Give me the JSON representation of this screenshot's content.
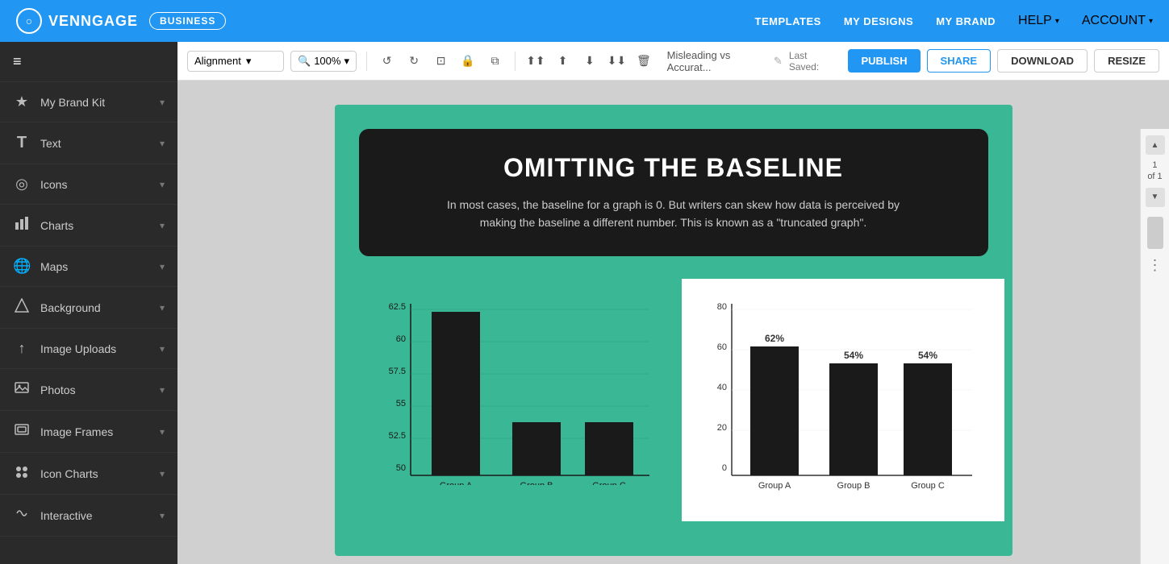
{
  "topnav": {
    "logo_text": "VENNGAGE",
    "logo_icon": "○",
    "business_badge": "BUSINESS",
    "links": [
      "TEMPLATES",
      "MY DESIGNS",
      "MY BRAND"
    ],
    "dropdowns": [
      "HELP",
      "ACCOUNT"
    ]
  },
  "toolbar": {
    "alignment_label": "Alignment",
    "zoom_label": "100%",
    "zoom_icon": "🔍",
    "title": "Misleading vs Accurat...",
    "save_label": "Last Saved:",
    "publish_label": "PUBLISH",
    "share_label": "SHARE",
    "download_label": "DOWNLOAD",
    "resize_label": "RESIZE"
  },
  "sidebar": {
    "hamburger_icon": "≡",
    "items": [
      {
        "id": "my-brand-kit",
        "icon": "★",
        "label": "My Brand Kit"
      },
      {
        "id": "text",
        "icon": "T",
        "label": "Text"
      },
      {
        "id": "icons",
        "icon": "◎",
        "label": "Icons"
      },
      {
        "id": "charts",
        "icon": "📊",
        "label": "Charts"
      },
      {
        "id": "maps",
        "icon": "🌐",
        "label": "Maps"
      },
      {
        "id": "background",
        "icon": "△",
        "label": "Background"
      },
      {
        "id": "image-uploads",
        "icon": "↑",
        "label": "Image Uploads"
      },
      {
        "id": "photos",
        "icon": "🖼",
        "label": "Photos"
      },
      {
        "id": "image-frames",
        "icon": "▢",
        "label": "Image Frames"
      },
      {
        "id": "icon-charts",
        "icon": "👥",
        "label": "Icon Charts"
      },
      {
        "id": "interactive",
        "icon": "⟳",
        "label": "Interactive"
      }
    ]
  },
  "canvas": {
    "bg_color": "#3ab795",
    "title_card": {
      "heading": "OMITTING THE BASELINE",
      "body": "In most cases, the baseline for a graph is 0. But writers can skew how data is perceived by making the baseline a different number. This is known as a \"truncated graph\"."
    },
    "left_chart": {
      "y_labels": [
        "62.5",
        "60",
        "57.5",
        "55",
        "52.5",
        "50"
      ],
      "x_labels": [
        "Group A",
        "Group B",
        "Group C"
      ],
      "bars": [
        {
          "group": "Group A",
          "value": 62,
          "height_pct": 95
        },
        {
          "group": "Group B",
          "value": 54,
          "height_pct": 38
        },
        {
          "group": "Group C",
          "value": 54,
          "height_pct": 35
        }
      ]
    },
    "right_chart": {
      "y_labels": [
        "80",
        "60",
        "40",
        "20",
        "0"
      ],
      "x_labels": [
        "Group A",
        "Group B",
        "Group C"
      ],
      "bars": [
        {
          "group": "Group A",
          "value": "62%",
          "height_pct": 77
        },
        {
          "group": "Group B",
          "value": "54%",
          "height_pct": 67
        },
        {
          "group": "Group C",
          "value": "54%",
          "height_pct": 67
        }
      ]
    }
  },
  "scrollbar": {
    "page_current": "1",
    "page_total": "1",
    "of_label": "of 1"
  }
}
